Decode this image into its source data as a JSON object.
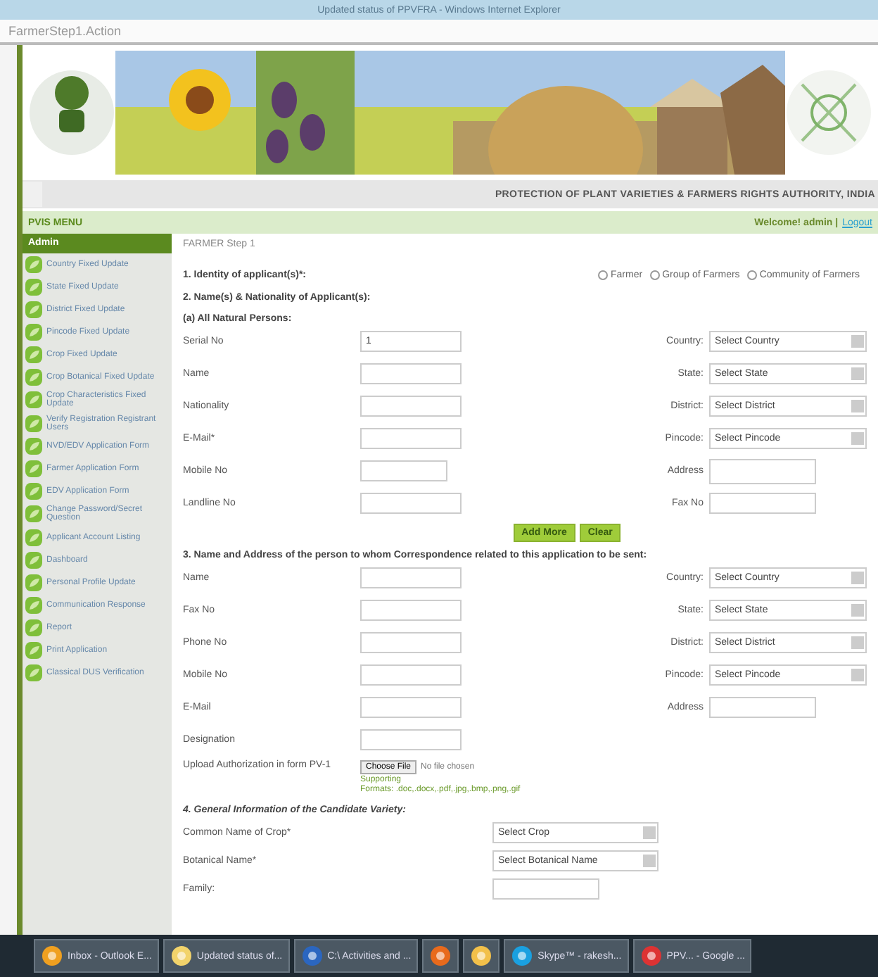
{
  "window": {
    "title": "Updated status of PPVFRA - Windows Internet Explorer"
  },
  "address_bar": {
    "text": "FarmerStep1.Action"
  },
  "header": {
    "authority": "PROTECTION OF PLANT VARIETIES & FARMERS RIGHTS AUTHORITY, INDIA",
    "menu_label": "PVIS MENU",
    "welcome": "Welcome! admin |",
    "logout": "Logout"
  },
  "sidebar": {
    "title": "Admin",
    "items": [
      {
        "label": "Country Fixed Update"
      },
      {
        "label": "State Fixed Update"
      },
      {
        "label": "District Fixed Update"
      },
      {
        "label": "Pincode Fixed Update"
      },
      {
        "label": "Crop Fixed Update"
      },
      {
        "label": "Crop Botanical Fixed Update"
      },
      {
        "label": "Crop Characteristics Fixed Update"
      },
      {
        "label": "Verify Registration Registrant Users"
      },
      {
        "label": "NVD/EDV Application Form"
      },
      {
        "label": "Farmer Application Form"
      },
      {
        "label": "EDV Application Form"
      },
      {
        "label": "Change Password/Secret Question"
      },
      {
        "label": "Applicant Account Listing"
      },
      {
        "label": "Dashboard"
      },
      {
        "label": "Personal Profile Update"
      },
      {
        "label": "Communication Response"
      },
      {
        "label": "Report"
      },
      {
        "label": "Print Application"
      },
      {
        "label": "Classical DUS Verification"
      }
    ]
  },
  "breadcrumb": "FARMER Step 1",
  "identity": {
    "label": "1. Identity of applicant(s)*:",
    "options": [
      {
        "label": "Farmer",
        "selected": false
      },
      {
        "label": "Group of Farmers",
        "selected": false
      },
      {
        "label": "Community of Farmers",
        "selected": false
      }
    ]
  },
  "applicant": {
    "heading": "2. Name(s) & Nationality of Applicant(s):",
    "subheading": "(a) All Natural Persons:",
    "left_fields": [
      {
        "label": "Serial No",
        "value": "1"
      },
      {
        "label": "Name"
      },
      {
        "label": "Nationality"
      },
      {
        "label": "E-Mail*"
      },
      {
        "label": "Mobile No",
        "kind": "short"
      },
      {
        "label": "Landline No"
      }
    ],
    "right_fields": [
      {
        "label": "Country:",
        "kind": "select",
        "value": "Select Country"
      },
      {
        "label": "State:",
        "kind": "select",
        "value": "Select State"
      },
      {
        "label": "District:",
        "kind": "select",
        "value": "Select District"
      },
      {
        "label": "Pincode:",
        "kind": "select",
        "value": "Select Pincode"
      },
      {
        "label": "Address",
        "kind": "textarea"
      },
      {
        "label": "Fax No",
        "kind": "text"
      }
    ],
    "buttons": [
      "Add More",
      "Clear"
    ]
  },
  "correspondence": {
    "heading": "3. Name and Address of the person to whom Correspondence related to this application to be sent:",
    "left_fields": [
      {
        "label": "Name"
      },
      {
        "label": "Fax No"
      },
      {
        "label": "Phone No"
      },
      {
        "label": "Mobile No"
      },
      {
        "label": "E-Mail"
      },
      {
        "label": "Designation"
      }
    ],
    "upload": {
      "label": "Upload Authorization in form PV-1",
      "button": "Choose File",
      "status": "No file chosen",
      "note": "Supporting",
      "formats": "Formats: .doc,.docx,.pdf,.jpg,.bmp,.png,.gif"
    },
    "right_fields": [
      {
        "label": "Country:",
        "kind": "select",
        "value": "Select Country"
      },
      {
        "label": "State:",
        "kind": "select",
        "value": "Select State"
      },
      {
        "label": "District:",
        "kind": "select",
        "value": "Select District"
      },
      {
        "label": "Pincode:",
        "kind": "select",
        "value": "Select Pincode"
      },
      {
        "label": "Address",
        "kind": "text"
      }
    ]
  },
  "variety": {
    "heading": "4. General Information of the Candidate Variety:",
    "fields": [
      {
        "label": "Common Name of Crop*",
        "kind": "select",
        "value": "Select Crop"
      },
      {
        "label": "Botanical Name*",
        "kind": "select",
        "value": "Select Botanical Name"
      },
      {
        "label": "Family:",
        "kind": "text"
      }
    ]
  },
  "taskbar": {
    "items": [
      {
        "kind": "outlook",
        "label": "Inbox - Outlook E..."
      },
      {
        "kind": "folder",
        "label": "Updated status of..."
      },
      {
        "kind": "word",
        "label": "C:\\ Activities and ..."
      },
      {
        "kind": "firefox"
      },
      {
        "kind": "paint"
      },
      {
        "kind": "skype",
        "label": "Skype™ - rakesh..."
      },
      {
        "kind": "chrome",
        "label": "PPV... - Google ..."
      }
    ]
  }
}
